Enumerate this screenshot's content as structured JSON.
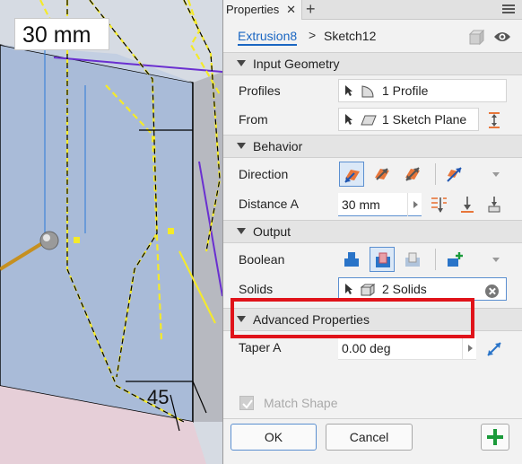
{
  "viewport": {
    "dimension_value": "30 mm",
    "angle_value": "45"
  },
  "panel": {
    "tab_label": "Properties",
    "close_glyph": "✕",
    "add_tab_glyph": "+",
    "breadcrumb": {
      "feature": "Extrusion8",
      "separator": ">",
      "sketch": "Sketch12"
    },
    "sections": {
      "input_geometry": "Input Geometry",
      "behavior": "Behavior",
      "output": "Output",
      "advanced": "Advanced Properties"
    },
    "input_geometry": {
      "profiles_label": "Profiles",
      "profiles_value": "1 Profile",
      "from_label": "From",
      "from_value": "1 Sketch Plane"
    },
    "behavior": {
      "direction_label": "Direction",
      "distance_label": "Distance A",
      "distance_value": "30 mm"
    },
    "output": {
      "boolean_label": "Boolean",
      "solids_label": "Solids",
      "solids_value": "2 Solids"
    },
    "advanced": {
      "taper_label": "Taper A",
      "taper_value": "0.00 deg",
      "match_shape_label": "Match Shape",
      "match_shape_checked": true
    },
    "buttons": {
      "ok": "OK",
      "cancel": "Cancel",
      "add": "+"
    }
  },
  "colors": {
    "accent": "#1a66c2",
    "highlight": "#e0131a",
    "add_green": "#1a9a3a",
    "direction_orange": "#e8763a"
  }
}
